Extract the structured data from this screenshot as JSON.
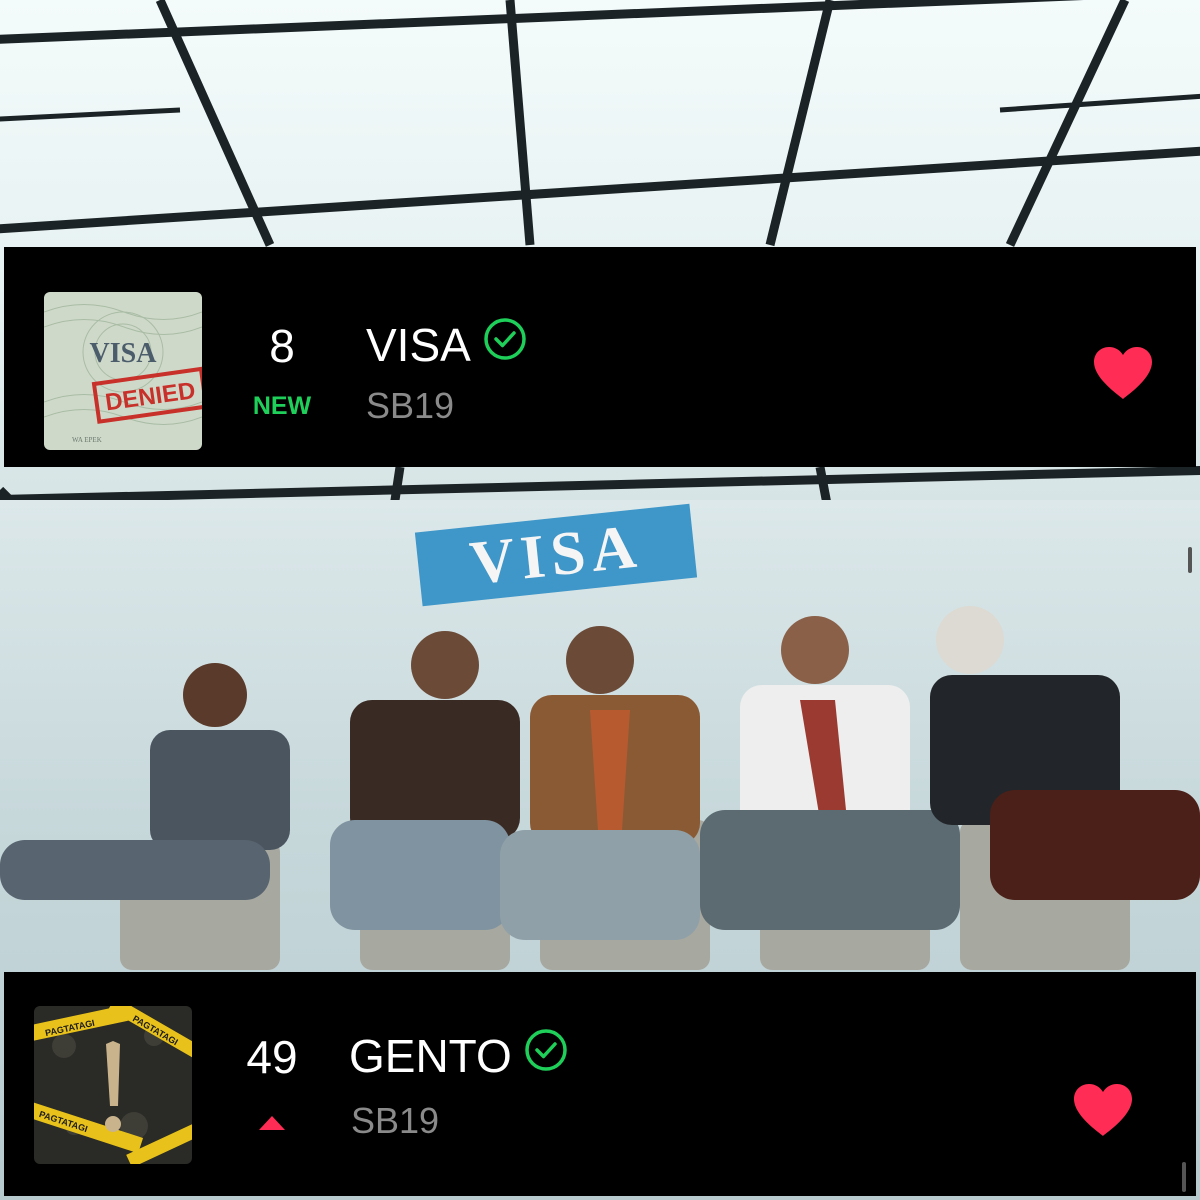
{
  "background": {
    "sign_text": "VISA"
  },
  "entries": [
    {
      "rank": "8",
      "status": "NEW",
      "title": "VISA",
      "artist": "SB19",
      "cover": {
        "stamp_text": "VISA",
        "denied_text": "DENIED",
        "small_text": "WA EPEK"
      },
      "verified": true,
      "liked": true
    },
    {
      "rank": "49",
      "status_icon": "up-arrow-icon",
      "title": "GENTO",
      "artist": "SB19",
      "cover": {
        "tape_text": "PAGTATAGI"
      },
      "verified": true,
      "liked": true
    }
  ],
  "colors": {
    "new": "#1ed05a",
    "verified": "#1ed05a",
    "heart": "#ff2d55",
    "up_arrow": "#ff2d55",
    "card_bg": "#000000"
  }
}
